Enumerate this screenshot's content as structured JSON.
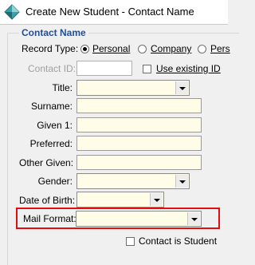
{
  "window": {
    "title": "Create New Student - Contact Name",
    "accent": "#1f4e9c"
  },
  "group": {
    "caption": "Contact Name"
  },
  "record_type": {
    "label": "Record Type:",
    "options": [
      {
        "label": "Personal",
        "selected": true
      },
      {
        "label": "Company",
        "selected": false
      },
      {
        "label": "Pers",
        "selected": false
      }
    ]
  },
  "contact_id": {
    "label": "Contact ID:",
    "value": "",
    "use_existing_label": "Use existing ID",
    "use_existing_checked": false
  },
  "fields": {
    "title": {
      "label": "Title:",
      "value": ""
    },
    "surname": {
      "label": "Surname:",
      "value": ""
    },
    "given1": {
      "label": "Given 1:",
      "value": ""
    },
    "preferred": {
      "label": "Preferred:",
      "value": ""
    },
    "other_given": {
      "label": "Other Given:",
      "value": ""
    },
    "gender": {
      "label": "Gender:",
      "value": ""
    },
    "dob": {
      "label": "Date of Birth:",
      "value": ""
    },
    "mail_format": {
      "label": "Mail Format:",
      "value": ""
    }
  },
  "contact_is_student": {
    "label": "Contact is Student",
    "checked": false
  },
  "highlight_color": "#e01010",
  "field_background": "#fffde7"
}
